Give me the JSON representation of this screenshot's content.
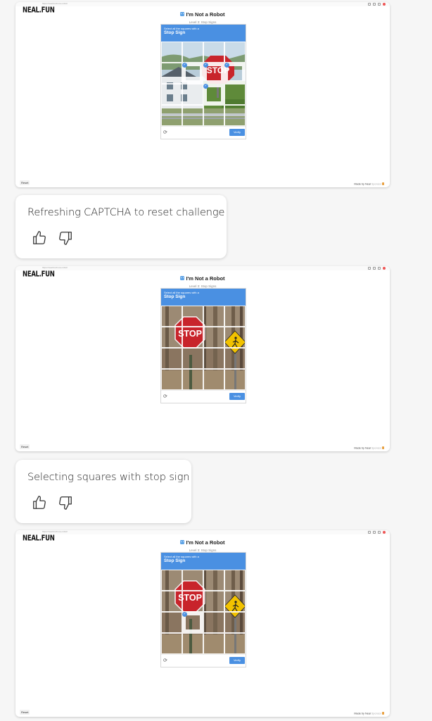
{
  "screenshots": [
    {
      "id": "shot-1",
      "url_text": "https://neal.fun/not-a-robot/",
      "logo": "NEAL.FUN",
      "title": "I'm Not a Robot",
      "subtitle": "Level 3: Stop Signs",
      "captcha": {
        "prompt": "Select all the squares with a",
        "target": "Stop Sign",
        "verify_label": "Verify",
        "refresh_icon": "refresh-icon",
        "selected_cells": [
          5,
          6,
          7,
          10
        ]
      },
      "reset_label": "Reset",
      "made_by_label": "Made by Neal",
      "made_by_brand": "Sponsor"
    },
    {
      "id": "shot-2",
      "url_text": "https://neal.fun/not-a-robot/",
      "logo": "NEAL.FUN",
      "title": "I'm Not a Robot",
      "subtitle": "Level 3: Stop Signs",
      "captcha": {
        "prompt": "Select all the squares with a",
        "target": "Stop Sign",
        "verify_label": "Verify",
        "refresh_icon": "refresh-icon",
        "selected_cells": []
      },
      "reset_label": "Reset",
      "made_by_label": "Made by Neal",
      "made_by_brand": "Sponsor"
    },
    {
      "id": "shot-3",
      "url_text": "https://neal.fun/not-a-robot/",
      "logo": "NEAL.FUN",
      "title": "I'm Not a Robot",
      "subtitle": "Level 3: Stop Signs",
      "captcha": {
        "prompt": "Select all the squares with a",
        "target": "Stop Sign",
        "verify_label": "Verify",
        "refresh_icon": "refresh-icon",
        "selected_cells": [
          9
        ]
      },
      "reset_label": "Reset",
      "made_by_label": "Made by Neal",
      "made_by_brand": "Sponsor"
    }
  ],
  "messages": [
    {
      "text": "Refreshing CAPTCHA to reset challenge",
      "like_icon": "thumbs-up-icon",
      "dislike_icon": "thumbs-down-icon"
    },
    {
      "text": "Selecting squares with stop sign",
      "like_icon": "thumbs-up-icon",
      "dislike_icon": "thumbs-down-icon"
    }
  ],
  "colors": {
    "captcha_blue": "#4a90e2",
    "stop_red": "#c8242b",
    "pedestrian_sign_yellow": "#f2c200"
  }
}
